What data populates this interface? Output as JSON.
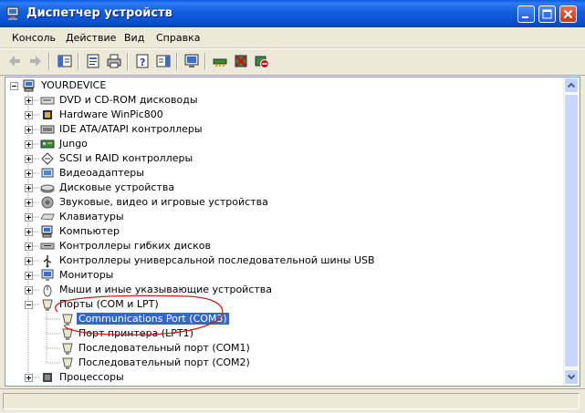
{
  "window": {
    "title": "Диспетчер устройств"
  },
  "menu": {
    "items": [
      "Консоль",
      "Действие",
      "Вид",
      "Справка"
    ]
  },
  "tree": {
    "root": "YOURDEVICE",
    "categories": [
      {
        "label": "DVD и CD-ROM дисководы",
        "icon": "dvd-drive-icon"
      },
      {
        "label": "Hardware WinPic800",
        "icon": "chip-icon"
      },
      {
        "label": "IDE ATA/ATAPI контроллеры",
        "icon": "ide-controller-icon"
      },
      {
        "label": "Jungo",
        "icon": "board-icon"
      },
      {
        "label": "SCSI и RAID контроллеры",
        "icon": "scsi-controller-icon"
      },
      {
        "label": "Видеоадаптеры",
        "icon": "display-adapter-icon"
      },
      {
        "label": "Дисковые устройства",
        "icon": "disk-drive-icon"
      },
      {
        "label": "Звуковые, видео и игровые устройства",
        "icon": "speaker-icon"
      },
      {
        "label": "Клавиатуры",
        "icon": "keyboard-icon"
      },
      {
        "label": "Компьютер",
        "icon": "computer-icon"
      },
      {
        "label": "Контроллеры гибких дисков",
        "icon": "floppy-controller-icon"
      },
      {
        "label": "Контроллеры универсальной последовательной шины USB",
        "icon": "usb-icon"
      },
      {
        "label": "Мониторы",
        "icon": "monitor-icon"
      },
      {
        "label": "Мыши и иные указывающие устройства",
        "icon": "mouse-icon"
      },
      {
        "label": "Порты (COM и LPT)",
        "icon": "port-icon",
        "expanded": true
      },
      {
        "label": "Процессоры",
        "icon": "processor-icon"
      }
    ],
    "ports_children": [
      {
        "label": "Communications Port (COM3)",
        "selected": true
      },
      {
        "label": "Порт принтера (LPT1)"
      },
      {
        "label": "Последовательный порт (COM1)"
      },
      {
        "label": "Последовательный порт (COM2)"
      }
    ]
  },
  "colors": {
    "title_bar": "#0A4FD0",
    "selection": "#316AC5",
    "annotation": "#D21E1E"
  }
}
